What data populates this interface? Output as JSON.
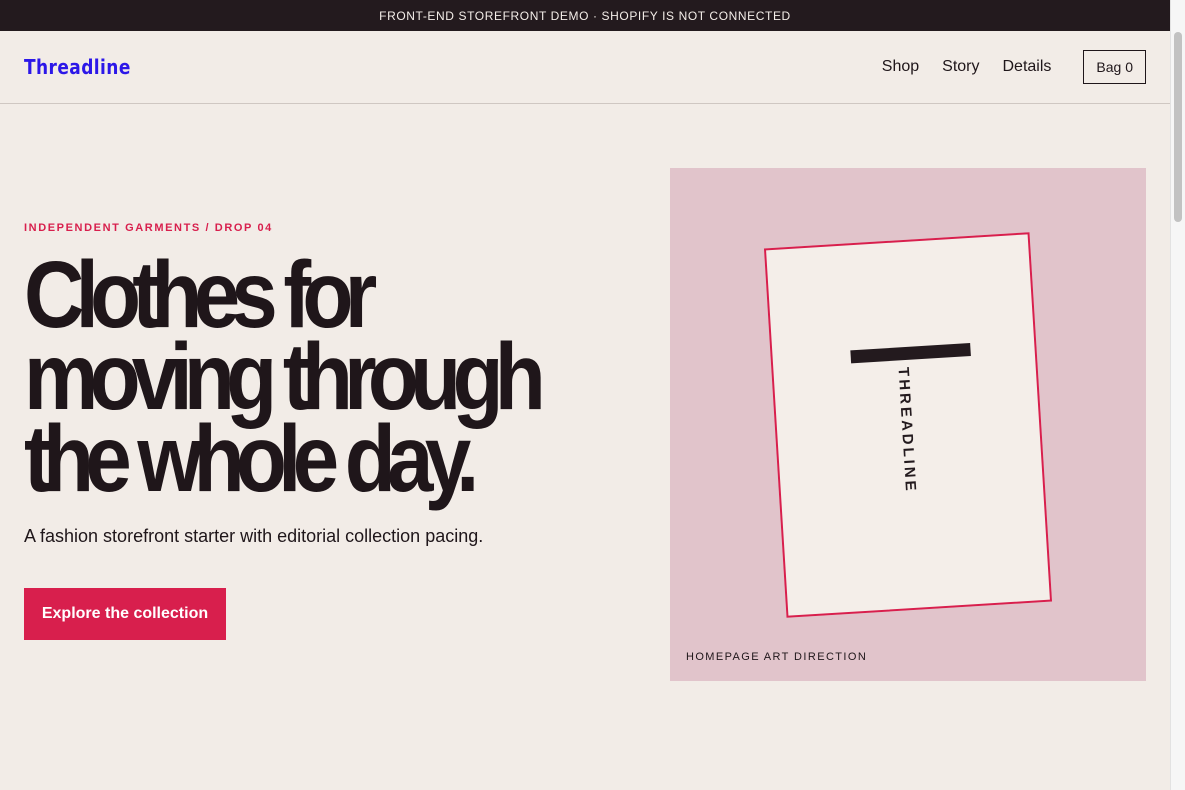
{
  "announcement": "FRONT-END STOREFRONT DEMO · SHOPIFY IS NOT CONNECTED",
  "brand": {
    "name": "Threadline",
    "color": "#2c17e8"
  },
  "nav": {
    "items": [
      {
        "label": "Shop"
      },
      {
        "label": "Story"
      },
      {
        "label": "Details"
      }
    ],
    "bag_label": "Bag 0"
  },
  "hero": {
    "eyebrow": "INDEPENDENT GARMENTS / DROP 04",
    "headline": [
      "Clothes for",
      "moving through",
      "the whole day."
    ],
    "subtitle": "A fashion storefront starter with editorial collection pacing.",
    "cta_label": "Explore the collection",
    "accent": "#d81f4d"
  },
  "art": {
    "card_text": "THREADLINE",
    "caption": "HOMEPAGE ART DIRECTION",
    "background": "#e1c4cb"
  }
}
